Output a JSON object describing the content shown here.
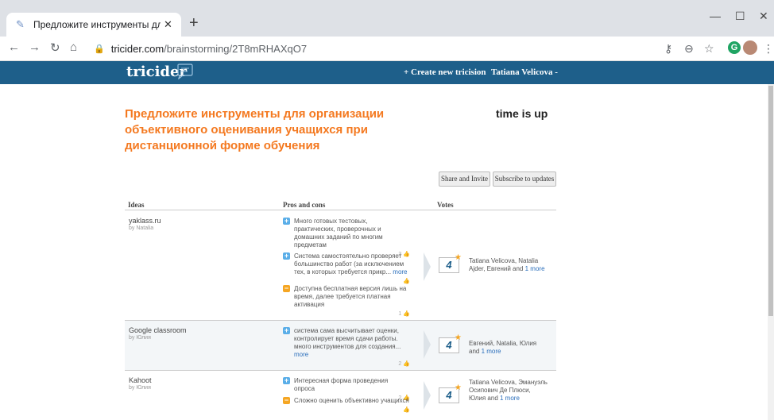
{
  "browser": {
    "tab_title": "Предложите инструменты для с",
    "url_domain": "tricider.com",
    "url_path": "/brainstorming/2T8mRHAXqO7"
  },
  "site": {
    "logo": "tricider",
    "create_link": "+ Create new tricision",
    "user_menu": "Tatiana Velicova -"
  },
  "page": {
    "question": "Предложите инструменты для организации объективного оценивания учащихся при дистанционной форме обучения",
    "status": "time is up",
    "share_button": "Share and Invite",
    "subscribe_button": "Subscribe to updates"
  },
  "table": {
    "headers": {
      "ideas": "Ideas",
      "pros": "Pros and cons",
      "votes": "Votes"
    },
    "rows": [
      {
        "idea": "yaklass.ru",
        "by": "by Natalia",
        "args": [
          {
            "type": "pro",
            "text": "Много готовых тестовых, практических, проверочных и домашних заданий по многим предметам",
            "more": "",
            "votes": "3"
          },
          {
            "type": "pro",
            "text": "Система самостоятельно проверяет большинство работ (за исключением тех, в которых требуется прикр...",
            "more": "more",
            "votes": ""
          },
          {
            "type": "con",
            "text": "Доступна бесплатная версия лишь на время, далее требуется платная активация",
            "more": "",
            "votes": "1"
          }
        ],
        "vote_count": "4",
        "voters": "Tatiana Velicova, Natalia Ajder, Евгений and",
        "voters_more": "1 more"
      },
      {
        "idea": "Google classroom",
        "by": "by Юлия",
        "args": [
          {
            "type": "pro",
            "text": "система сама высчитывает оценки, контролирует время сдачи работы. много инструментов для создания...",
            "more": "more",
            "votes": "2"
          }
        ],
        "vote_count": "4",
        "voters": "Евгений, Natalia, Юлия and",
        "voters_more": "1 more"
      },
      {
        "idea": "Kahoot",
        "by": "by Юлия",
        "args": [
          {
            "type": "pro",
            "text": "Интересная форма проведения опроса",
            "more": "",
            "votes": "2"
          },
          {
            "type": "con",
            "text": "Сложно оценить объективно учащихся",
            "more": "",
            "votes": ""
          }
        ],
        "vote_count": "4",
        "voters": "Tatiana Velicova, Эмануэль Осипович Де Плюси, Юлия and",
        "voters_more": "1 more"
      }
    ]
  },
  "colors": {
    "header_bg": "#1e5f8a",
    "title_orange": "#f47920",
    "pro_blue": "#5aaee8",
    "con_orange": "#f5a623"
  }
}
